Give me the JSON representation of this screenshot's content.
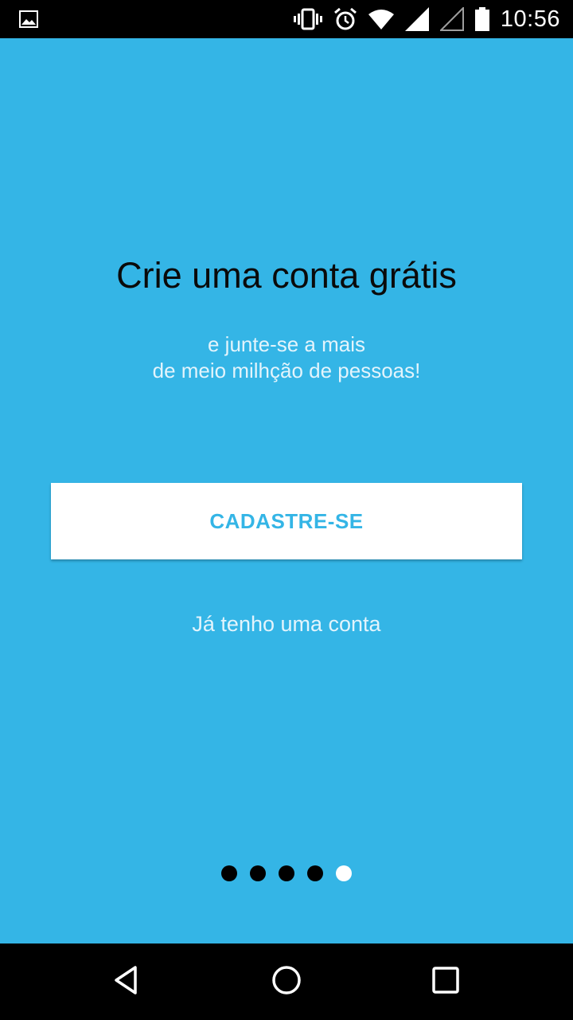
{
  "status_bar": {
    "time": "10:56",
    "icons": [
      "image-notification-icon",
      "vibrate-icon",
      "alarm-icon",
      "wifi-icon",
      "signal-icon",
      "signal-empty-icon",
      "battery-icon"
    ]
  },
  "onboarding": {
    "title": "Crie uma conta grátis",
    "subtitle_line1": "e junte-se a mais",
    "subtitle_line2": "de meio milhção de pessoas!",
    "signup_label": "CADASTRE-SE",
    "login_label": "Já tenho uma conta",
    "pager": {
      "count": 5,
      "active_index": 4
    }
  },
  "nav_bar": {
    "icons": [
      "back-icon",
      "home-icon",
      "recents-icon"
    ]
  },
  "colors": {
    "background": "#34b5e6",
    "title": "#0a0a0a",
    "subtitle": "#e3f4fc",
    "button_bg": "#ffffff",
    "button_text": "#34b5e6"
  }
}
